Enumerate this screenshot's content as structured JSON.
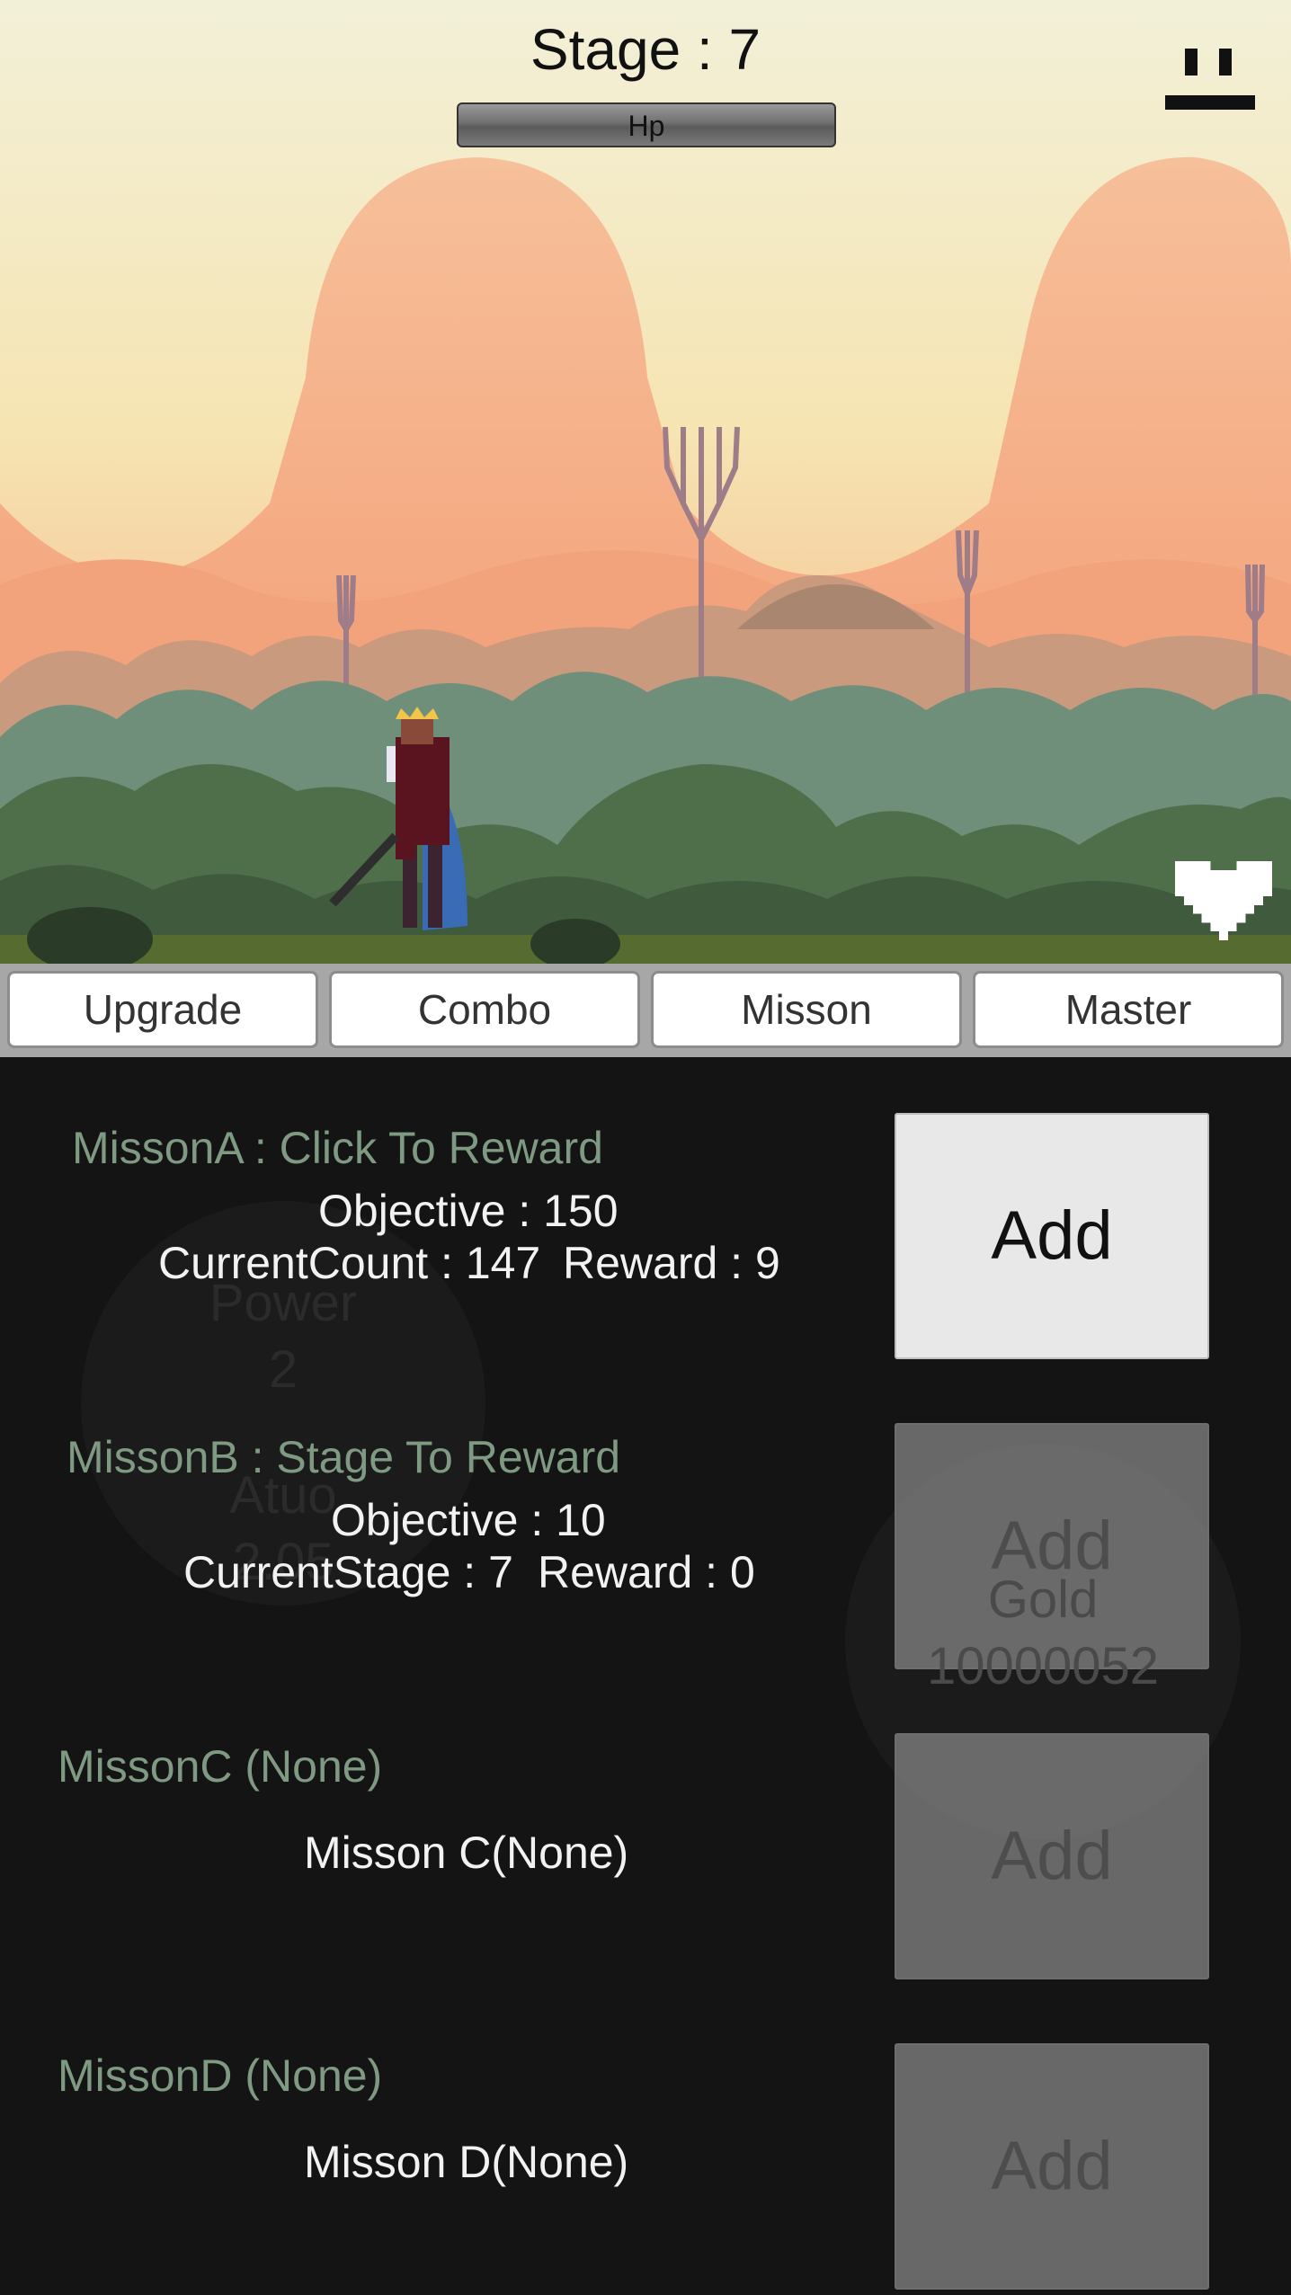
{
  "header": {
    "stage_text": "Stage : 7",
    "hp_label": "Hp",
    "hp_fraction": 1.0
  },
  "icons": {
    "pause": "pause-icon",
    "heart": "heart-icon",
    "hero": "king-knight-sprite"
  },
  "tabs": [
    {
      "label": "Upgrade"
    },
    {
      "label": "Combo"
    },
    {
      "label": "Misson"
    },
    {
      "label": "Master"
    }
  ],
  "background_stats": {
    "power_label": "Power",
    "power_value": "2",
    "auto_label": "Atuo",
    "auto_value": "2.05",
    "gold_label": "Gold",
    "gold_value": "10000052"
  },
  "missions": {
    "a": {
      "title": "MissonA : Click To Reward",
      "objective": "Objective : 150",
      "current": "CurrentCount : 147",
      "reward": "Reward : 9",
      "button": "Add"
    },
    "b": {
      "title": "MissonB : Stage To Reward",
      "objective": "Objective : 10",
      "current": "CurrentStage : 7",
      "reward": "Reward : 0",
      "button": "Add"
    },
    "c": {
      "title": "MissonC (None)",
      "body": "Misson C(None)",
      "button": "Add"
    },
    "d": {
      "title": "MissonD (None)",
      "body": "Misson D(None)",
      "button": "Add"
    }
  },
  "colors": {
    "panel_bg": "#141414",
    "mission_title": "#7f9a82",
    "sky": "#f1efd6",
    "mountain": "#f7b98e"
  }
}
